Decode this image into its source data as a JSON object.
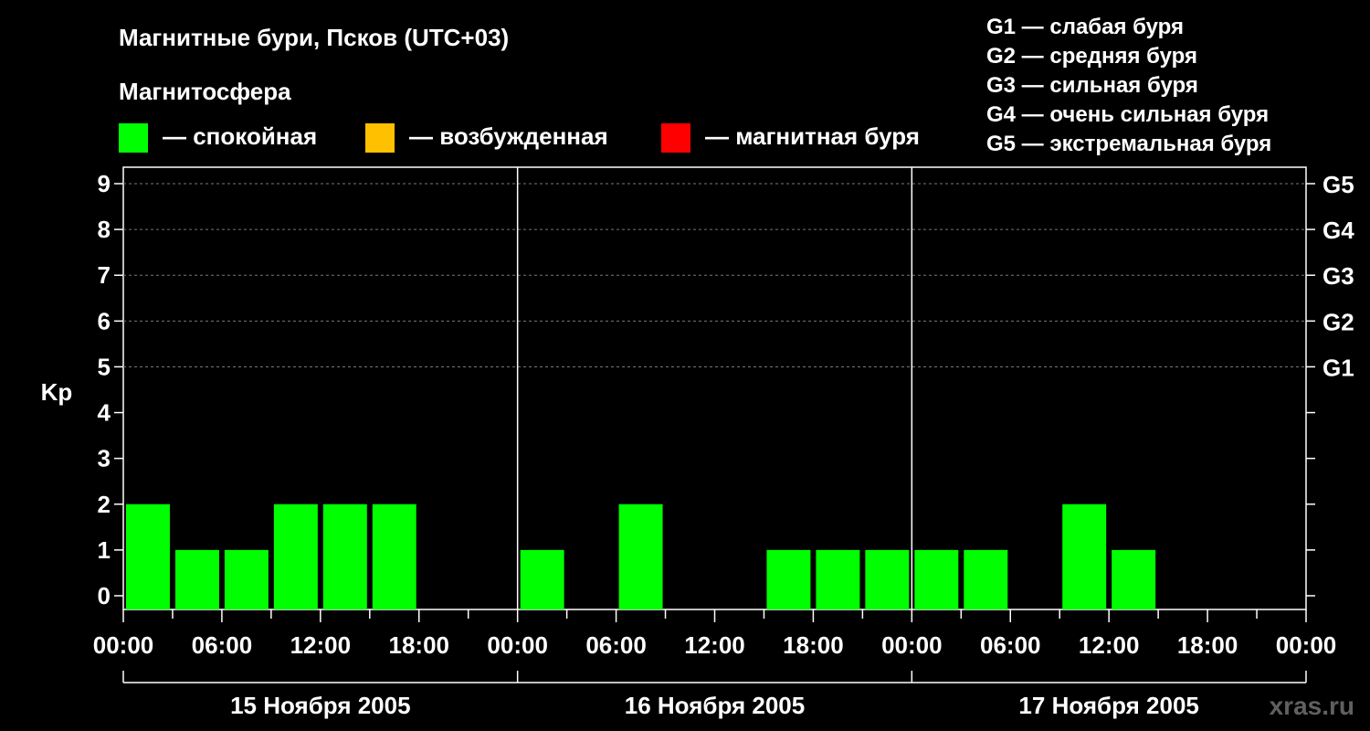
{
  "chart_data": {
    "type": "bar",
    "title": "Магнитные бури, Псков (UTC+03)",
    "legend_title": "Магнитосфера",
    "legend": [
      {
        "label": "— спокойная",
        "color": "#00ff00"
      },
      {
        "label": "— возбужденная",
        "color": "#ffc000"
      },
      {
        "label": "— магнитная буря",
        "color": "#ff0000"
      }
    ],
    "storm_levels": [
      "G1 — слабая буря",
      "G2 — средняя буря",
      "G3 — сильная буря",
      "G4 — очень сильная буря",
      "G5 — экстремальная буря"
    ],
    "ylabel": "Kp",
    "ylim": [
      0,
      9
    ],
    "yticks": [
      0,
      1,
      2,
      3,
      4,
      5,
      6,
      7,
      8,
      9
    ],
    "right_ticks": [
      {
        "value": 5,
        "label": "G1"
      },
      {
        "value": 6,
        "label": "G2"
      },
      {
        "value": 7,
        "label": "G3"
      },
      {
        "value": 8,
        "label": "G4"
      },
      {
        "value": 9,
        "label": "G5"
      }
    ],
    "xtick_labels": [
      "00:00",
      "06:00",
      "12:00",
      "18:00",
      "00:00",
      "06:00",
      "12:00",
      "18:00",
      "00:00",
      "06:00",
      "12:00",
      "18:00",
      "00:00"
    ],
    "days": [
      "15 Ноября 2005",
      "16 Ноября 2005",
      "17 Ноября 2005"
    ],
    "grid": "horizontal dashed at 5-9",
    "bar_color": "#00ff00",
    "values": [
      2,
      1,
      1,
      2,
      2,
      2,
      0,
      0,
      1,
      0,
      2,
      0,
      0,
      1,
      1,
      1,
      1,
      1,
      0,
      2,
      1,
      0,
      0,
      0
    ],
    "watermark": "xras.ru"
  }
}
